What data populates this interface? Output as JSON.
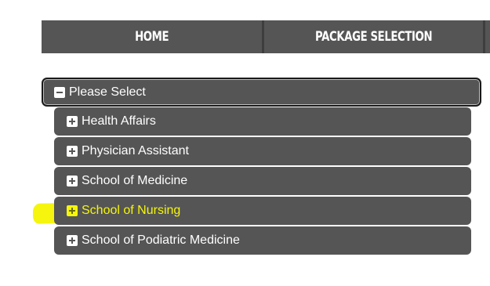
{
  "nav": {
    "items": [
      {
        "label": "Home"
      },
      {
        "label": "Package Selection"
      }
    ]
  },
  "dropdown": {
    "selected_label": "Please Select",
    "expanded_icon": "minus-box-icon",
    "options": [
      {
        "label": "Health Affairs",
        "icon": "plus-box-icon"
      },
      {
        "label": "Physician Assistant",
        "icon": "plus-box-icon"
      },
      {
        "label": "School of Medicine",
        "icon": "plus-box-icon"
      },
      {
        "label": "School of Nursing",
        "icon": "plus-box-icon",
        "highlighted": true
      },
      {
        "label": "School of Podiatric Medicine",
        "icon": "plus-box-icon"
      }
    ]
  },
  "colors": {
    "bar_bg": "#555555",
    "text": "#ffffff",
    "highlight": "#f5f50a",
    "marker": "#f4f400"
  }
}
